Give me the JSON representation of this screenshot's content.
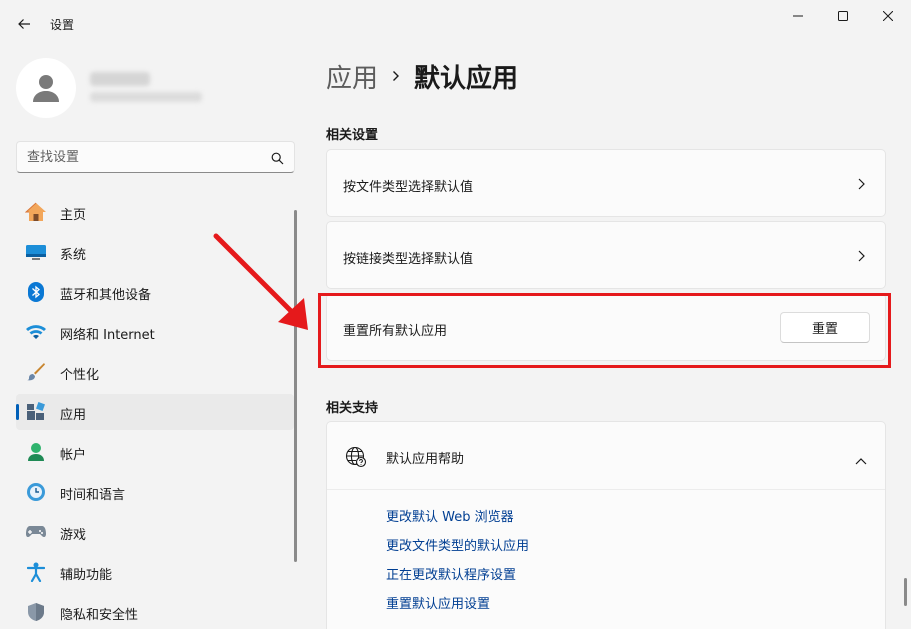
{
  "window": {
    "title": "设置"
  },
  "search": {
    "placeholder": "查找设置"
  },
  "sidebar": {
    "items": [
      {
        "label": "主页",
        "icon": "home-icon"
      },
      {
        "label": "系统",
        "icon": "system-icon"
      },
      {
        "label": "蓝牙和其他设备",
        "icon": "bluetooth-icon"
      },
      {
        "label": "网络和 Internet",
        "icon": "wifi-icon"
      },
      {
        "label": "个性化",
        "icon": "brush-icon"
      },
      {
        "label": "应用",
        "icon": "apps-icon",
        "active": true
      },
      {
        "label": "帐户",
        "icon": "account-icon"
      },
      {
        "label": "时间和语言",
        "icon": "time-language-icon"
      },
      {
        "label": "游戏",
        "icon": "gamepad-icon"
      },
      {
        "label": "辅助功能",
        "icon": "accessibility-icon"
      },
      {
        "label": "隐私和安全性",
        "icon": "shield-icon"
      }
    ]
  },
  "breadcrumb": {
    "parent": "应用",
    "current": "默认应用"
  },
  "related_settings": {
    "title": "相关设置",
    "items": [
      {
        "label": "按文件类型选择默认值"
      },
      {
        "label": "按链接类型选择默认值"
      }
    ],
    "reset": {
      "label": "重置所有默认应用",
      "button": "重置"
    }
  },
  "related_support": {
    "title": "相关支持",
    "help": {
      "label": "默认应用帮助",
      "links": [
        "更改默认 Web 浏览器",
        "更改文件类型的默认应用",
        "正在更改默认程序设置",
        "重置默认应用设置"
      ]
    }
  },
  "colors": {
    "accent": "#005fb8",
    "highlight": "#e5191b",
    "link": "#003e92"
  }
}
